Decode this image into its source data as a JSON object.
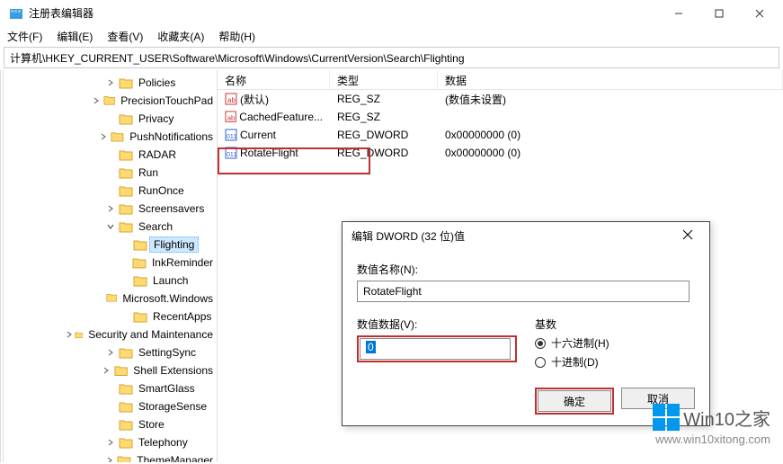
{
  "window": {
    "title": "注册表编辑器"
  },
  "menu": {
    "file": "文件(F)",
    "edit": "编辑(E)",
    "view": "查看(V)",
    "favorites": "收藏夹(A)",
    "help": "帮助(H)"
  },
  "path": "计算机\\HKEY_CURRENT_USER\\Software\\Microsoft\\Windows\\CurrentVersion\\Search\\Flighting",
  "tree": [
    {
      "indent": 3,
      "expander": ">",
      "label": "Policies"
    },
    {
      "indent": 3,
      "expander": ">",
      "label": "PrecisionTouchPad"
    },
    {
      "indent": 3,
      "expander": "",
      "label": "Privacy"
    },
    {
      "indent": 3,
      "expander": ">",
      "label": "PushNotifications"
    },
    {
      "indent": 3,
      "expander": "",
      "label": "RADAR"
    },
    {
      "indent": 3,
      "expander": "",
      "label": "Run"
    },
    {
      "indent": 3,
      "expander": "",
      "label": "RunOnce"
    },
    {
      "indent": 3,
      "expander": ">",
      "label": "Screensavers"
    },
    {
      "indent": 3,
      "expander": "v",
      "label": "Search"
    },
    {
      "indent": 4,
      "expander": "",
      "label": "Flighting",
      "selected": true
    },
    {
      "indent": 4,
      "expander": "",
      "label": "InkReminder"
    },
    {
      "indent": 4,
      "expander": "",
      "label": "Launch"
    },
    {
      "indent": 4,
      "expander": "",
      "label": "Microsoft.Windows"
    },
    {
      "indent": 4,
      "expander": "",
      "label": "RecentApps"
    },
    {
      "indent": 3,
      "expander": ">",
      "label": "Security and Maintenance"
    },
    {
      "indent": 3,
      "expander": ">",
      "label": "SettingSync"
    },
    {
      "indent": 3,
      "expander": ">",
      "label": "Shell Extensions"
    },
    {
      "indent": 3,
      "expander": "",
      "label": "SmartGlass"
    },
    {
      "indent": 3,
      "expander": "",
      "label": "StorageSense"
    },
    {
      "indent": 3,
      "expander": "",
      "label": "Store"
    },
    {
      "indent": 3,
      "expander": ">",
      "label": "Telephony"
    },
    {
      "indent": 3,
      "expander": ">",
      "label": "ThemeManager"
    }
  ],
  "columns": {
    "name": "名称",
    "type": "类型",
    "data": "数据"
  },
  "values": [
    {
      "icon": "str",
      "name": "(默认)",
      "type": "REG_SZ",
      "data": "(数值未设置)"
    },
    {
      "icon": "str",
      "name": "CachedFeature...",
      "type": "REG_SZ",
      "data": ""
    },
    {
      "icon": "bin",
      "name": "Current",
      "type": "REG_DWORD",
      "data": "0x00000000 (0)"
    },
    {
      "icon": "bin",
      "name": "RotateFlight",
      "type": "REG_DWORD",
      "data": "0x00000000 (0)"
    }
  ],
  "dialog": {
    "title": "编辑 DWORD (32 位)值",
    "name_label": "数值名称(N):",
    "name_value": "RotateFlight",
    "data_label": "数值数据(V):",
    "data_value": "0",
    "base_label": "基数",
    "radix_hex": "十六进制(H)",
    "radix_dec": "十进制(D)",
    "ok": "确定",
    "cancel": "取消"
  },
  "watermark": {
    "brand_a": "Win10",
    "brand_b": "之家",
    "url": "www.win10xitong.com"
  }
}
